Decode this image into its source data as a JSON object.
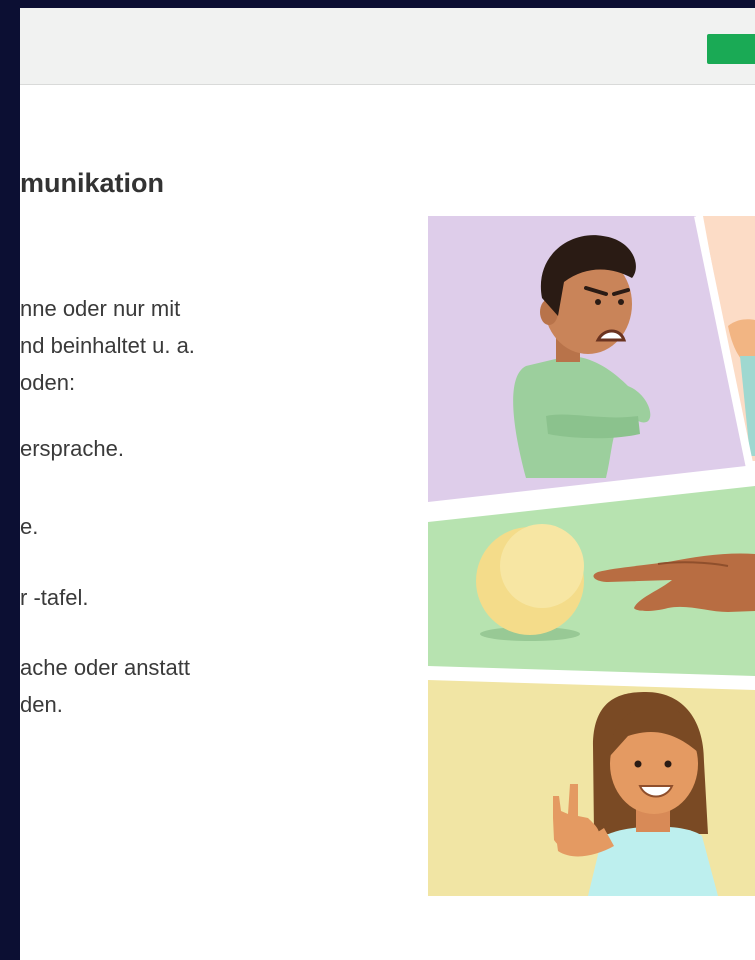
{
  "page": {
    "title": "munikation",
    "paragraph_lines": [
      "nne oder nur mit",
      "nd beinhaltet u. a.",
      "oden:",
      "ersprache.",
      "e.",
      "r -tafel.",
      "ache oder anstatt",
      "den."
    ]
  },
  "colors": {
    "outer_background": "#0c0f33",
    "topbar": "#f1f2f1",
    "progress_green": "#1aaa55",
    "panel_purple": "#decdea",
    "panel_peach": "#fcdcc6",
    "panel_green": "#b7e3b0",
    "panel_yellow": "#f1e5a4"
  },
  "illustration": {
    "panels": [
      "angry-boy-panel",
      "pointing-ball-panel",
      "girl-sign-language-panel"
    ],
    "icons": [
      "angry-boy-icon",
      "ball-icon",
      "pointing-hand-icon",
      "girl-sign-icon"
    ]
  }
}
